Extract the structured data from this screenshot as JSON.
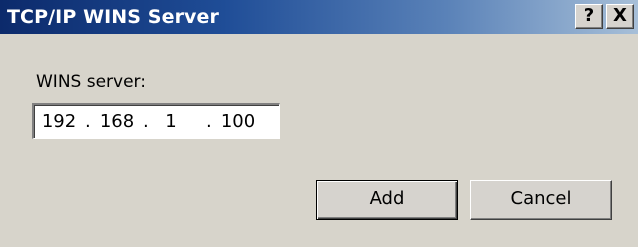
{
  "window": {
    "title": "TCP/IP WINS Server",
    "help_button": "?",
    "close_button": "X"
  },
  "form": {
    "label": "WINS server:",
    "ip_octets": [
      "192",
      "168",
      "1",
      "100"
    ],
    "separator": "."
  },
  "buttons": {
    "add": "Add",
    "cancel": "Cancel"
  },
  "colors": {
    "title_start": "#0c2a6b",
    "title_end": "#a7bfd8",
    "face": "#d6d3ce"
  }
}
